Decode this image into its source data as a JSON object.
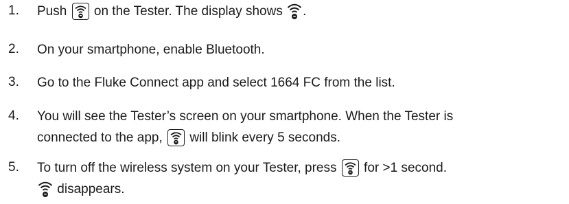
{
  "steps": [
    {
      "number": "1.",
      "segments": [
        "Push ",
        " on the Tester. The display shows ",
        "."
      ]
    },
    {
      "number": "2.",
      "text": "On your smartphone, enable Bluetooth."
    },
    {
      "number": "3.",
      "text": "Go to the Fluke Connect app and select 1664 FC from the list."
    },
    {
      "number": "4.",
      "line1": "You will see the Tester’s screen on your smartphone. When the Tester is",
      "line2_segments": [
        "connected to the app, ",
        " will blink every 5 seconds."
      ]
    },
    {
      "number": "5.",
      "line1_segments": [
        "To turn off the wireless system on your Tester, press ",
        " for >1 second."
      ],
      "line2_segments": [
        " disappears."
      ]
    }
  ],
  "icons": {
    "button": "wireless-button-icon",
    "display": "wireless-display-icon"
  }
}
